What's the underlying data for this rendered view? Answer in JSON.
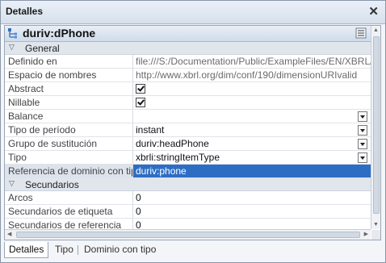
{
  "window": {
    "title": "Detalles",
    "close_glyph": "✕"
  },
  "header": {
    "name": "duriv:dPhone",
    "icon": "dimension-node-icon",
    "menu_icon": "menu-toggle-icon"
  },
  "sections": [
    {
      "label": "General",
      "rows": [
        {
          "key": "Definido en",
          "value": "file:///S:/Documentation/Public/ExampleFiles/EN/XBRL/Typ",
          "type": "text",
          "gray": true
        },
        {
          "key": "Espacio de nombres",
          "value": "http://www.xbrl.org/dim/conf/190/dimensionURIvalid",
          "type": "text",
          "gray": true
        },
        {
          "key": "Abstract",
          "value": "",
          "type": "checkbox",
          "checked": true
        },
        {
          "key": "Nillable",
          "value": "",
          "type": "checkbox",
          "checked": true
        },
        {
          "key": "Balance",
          "value": "",
          "type": "dropdown"
        },
        {
          "key": "Tipo de período",
          "value": "instant",
          "type": "dropdown"
        },
        {
          "key": "Grupo de sustitución",
          "value": "duriv:headPhone",
          "type": "dropdown"
        },
        {
          "key": "Tipo",
          "value": "xbrli:stringItemType",
          "type": "dropdown"
        },
        {
          "key": "Referencia de dominio con tipo",
          "value": "duriv:phone",
          "type": "text",
          "selected": true
        }
      ]
    },
    {
      "label": "Secundarios",
      "rows": [
        {
          "key": "Arcos",
          "value": "0",
          "type": "text"
        },
        {
          "key": "Secundarios de etiqueta",
          "value": "0",
          "type": "text"
        },
        {
          "key": "Secundarios de referencia",
          "value": "0",
          "type": "text"
        }
      ]
    }
  ],
  "tabs": [
    {
      "label": "Detalles",
      "active": true
    },
    {
      "label": "Tipo",
      "active": false
    },
    {
      "label": "Dominio con tipo",
      "active": false
    }
  ],
  "colors": {
    "selection": "#2d6ec4",
    "section_bg": "#e1e6ed"
  }
}
